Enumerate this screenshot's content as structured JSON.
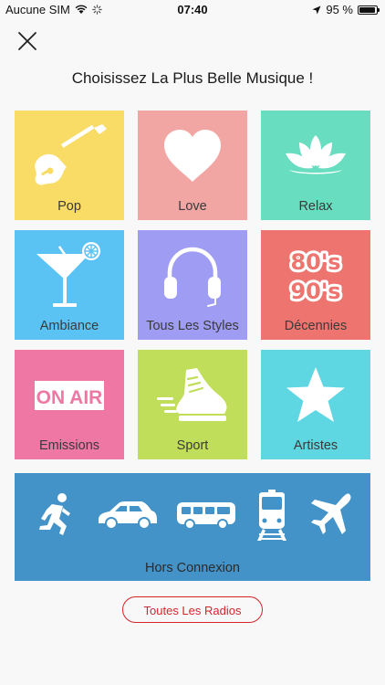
{
  "status_bar": {
    "carrier": "Aucune SIM",
    "time": "07:40",
    "battery": "95 %",
    "battery_level": 0.95
  },
  "title": "Choisissez La Plus Belle Musique !",
  "tiles": [
    {
      "label": "Pop",
      "color": "#f8dc66",
      "icon": "guitar-icon"
    },
    {
      "label": "Love",
      "color": "#f2a6a3",
      "icon": "heart-icon"
    },
    {
      "label": "Relax",
      "color": "#69ddc0",
      "icon": "lotus-icon"
    },
    {
      "label": "Ambiance",
      "color": "#5bc2f4",
      "icon": "cocktail-icon"
    },
    {
      "label": "Tous Les Styles",
      "color": "#9f9cf3",
      "icon": "headphones-icon"
    },
    {
      "label": "Décennies",
      "color": "#ee756f",
      "icon": "decades-icon",
      "icon_text": [
        "80's",
        "90's"
      ]
    },
    {
      "label": "Emissions",
      "color": "#ee77a4",
      "icon": "on-air-icon",
      "icon_text": "ON AIR"
    },
    {
      "label": "Sport",
      "color": "#c0de5a",
      "icon": "sneaker-icon"
    },
    {
      "label": "Artistes",
      "color": "#5fd7e3",
      "icon": "star-icon"
    }
  ],
  "offline": {
    "label": "Hors Connexion",
    "color": "#4393c9",
    "icons": [
      "runner-icon",
      "car-icon",
      "bus-icon",
      "train-icon",
      "plane-icon"
    ]
  },
  "all_radios_button": "Toutes Les Radios",
  "accent_color": "#d4252b"
}
